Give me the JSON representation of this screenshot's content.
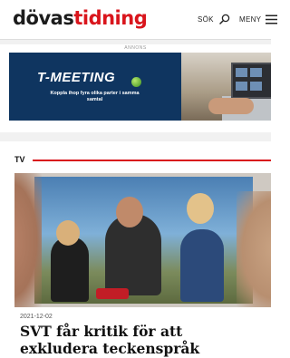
{
  "header": {
    "logo_part1": "dövas",
    "logo_part2": "tidning",
    "search_label": "SÖK",
    "menu_label": "MENY",
    "brand_color": "#d9151c"
  },
  "ad": {
    "label": "ANNONS",
    "brand": "T-MEETING",
    "tagline": "Koppla ihop fyra olika parter i samma samtal"
  },
  "section": {
    "name": "TV",
    "accent": "#d9151c"
  },
  "article": {
    "date": "2021-12-02",
    "title": "SVT får kritik för att exkludera teckenspråk"
  },
  "icons": [
    "search-icon",
    "menu-icon"
  ]
}
